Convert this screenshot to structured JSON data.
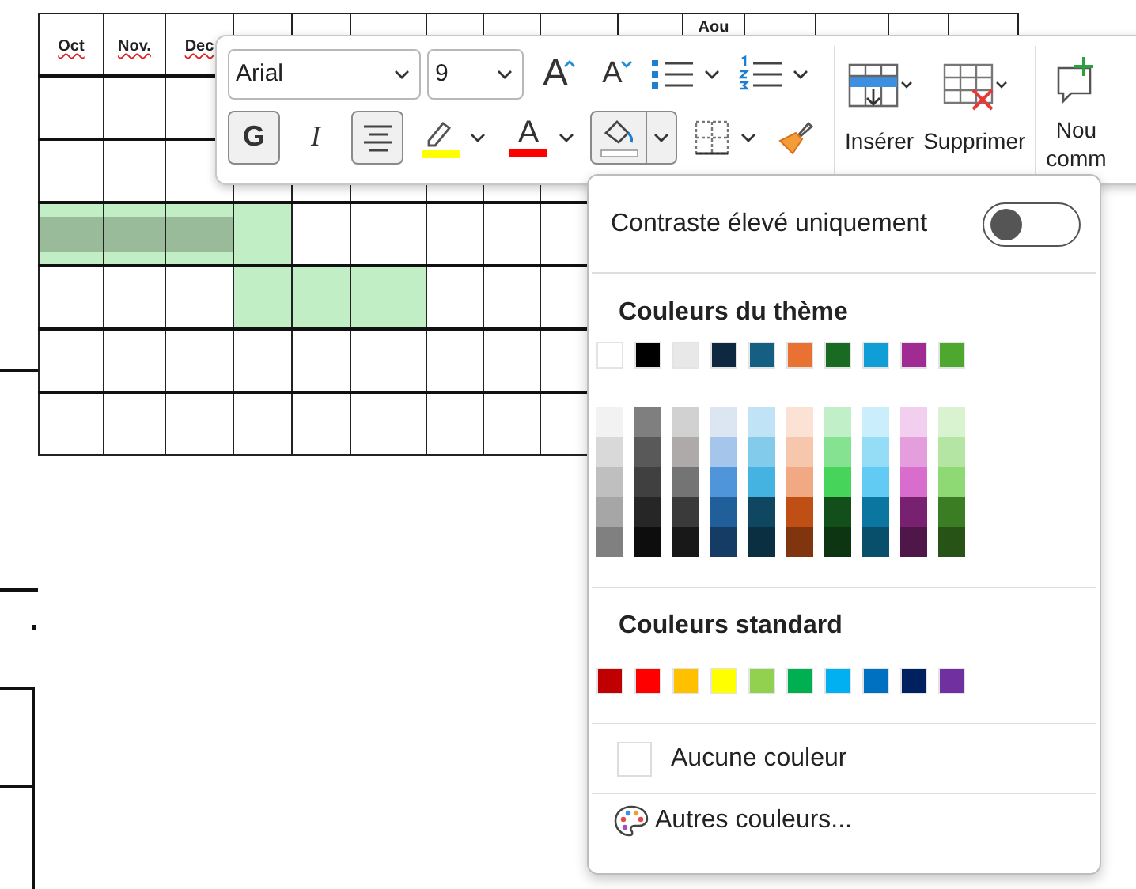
{
  "document": {
    "table": {
      "header_labels": [
        {
          "text": "Oct",
          "misspelled": true
        },
        {
          "text": "Nov.",
          "misspelled": true
        },
        {
          "text": "Dec",
          "misspelled": true
        }
      ],
      "cut_header": "Aou",
      "rows": [
        {
          "cells": [
            {
              "shaded": false
            },
            {
              "shaded": false
            },
            {
              "shaded": false
            }
          ]
        },
        {
          "cells": [
            {
              "shaded": false
            },
            {
              "shaded": false
            },
            {
              "shaded": false
            },
            {
              "shaded": false
            },
            {
              "shaded": false
            },
            {
              "shaded": false
            },
            {
              "shaded": false
            },
            {
              "shaded": false
            },
            {
              "shaded": false
            }
          ]
        },
        {
          "cells": [
            {
              "shaded": true,
              "selected": true
            },
            {
              "shaded": true,
              "selected": true
            },
            {
              "shaded": true,
              "selected": true
            },
            {
              "shaded": true,
              "selected": false
            },
            {
              "shaded": false,
              "selected": false
            },
            {
              "shaded": false,
              "selected": false
            },
            {
              "shaded": false,
              "selected": false
            },
            {
              "shaded": false,
              "selected": false
            },
            {
              "shaded": false,
              "selected": false
            }
          ]
        },
        {
          "cells": [
            {
              "shaded": false
            },
            {
              "shaded": false
            },
            {
              "shaded": false
            },
            {
              "shaded": true
            },
            {
              "shaded": true
            },
            {
              "shaded": true
            },
            {
              "shaded": false
            },
            {
              "shaded": false
            },
            {
              "shaded": false
            }
          ]
        },
        {
          "cells": [
            {
              "shaded": false
            },
            {
              "shaded": false
            },
            {
              "shaded": false
            },
            {
              "shaded": false
            },
            {
              "shaded": false
            },
            {
              "shaded": false
            },
            {
              "shaded": false
            },
            {
              "shaded": false
            },
            {
              "shaded": false
            }
          ]
        },
        {
          "cells": [
            {
              "shaded": false
            },
            {
              "shaded": false
            },
            {
              "shaded": false
            },
            {
              "shaded": false
            },
            {
              "shaded": false
            },
            {
              "shaded": false
            },
            {
              "shaded": false
            },
            {
              "shaded": false
            },
            {
              "shaded": false
            }
          ]
        }
      ]
    }
  },
  "mini_toolbar": {
    "font_field": {
      "value": "Arial"
    },
    "size_field": {
      "value": "9"
    },
    "row_1": [
      {
        "kind": "grow_font",
        "glyph": "A"
      },
      {
        "kind": "shrink_font",
        "glyph": "A"
      },
      {
        "kind": "bullets"
      },
      {
        "kind": "numbering"
      }
    ],
    "row_2": [
      {
        "kind": "bold",
        "glyph": "G",
        "on": true
      },
      {
        "kind": "italic",
        "glyph": "I",
        "on": false
      },
      {
        "kind": "align_center",
        "on": true
      },
      {
        "kind": "highlight"
      },
      {
        "kind": "font_color",
        "glyph": "A"
      },
      {
        "kind": "fill",
        "expanded": true
      },
      {
        "kind": "borders"
      },
      {
        "kind": "format_painter"
      }
    ],
    "actions": [
      {
        "kind": "insert",
        "label": "Insérer"
      },
      {
        "kind": "delete",
        "label": "Supprimer"
      },
      {
        "kind": "comment",
        "label_lines": [
          "Nou",
          "comm"
        ]
      }
    ]
  },
  "color_menu": {
    "contrast_toggle": {
      "label": "Contraste élevé uniquement",
      "on": false
    },
    "theme_heading": "Couleurs du thème",
    "theme_colors": [
      {
        "color": "#ffffff"
      },
      {
        "color": "#000000"
      },
      {
        "color": "#e8e8e8"
      },
      {
        "color": "#0e2841"
      },
      {
        "color": "#156082"
      },
      {
        "color": "#e97132"
      },
      {
        "color": "#196b24"
      },
      {
        "color": "#0f9ed5"
      },
      {
        "color": "#a02b93"
      },
      {
        "color": "#4ea72e"
      }
    ],
    "theme_shades": [
      [
        {
          "color": "#f2f2f2"
        },
        {
          "color": "#d9d9d9"
        },
        {
          "color": "#bfbfbf"
        },
        {
          "color": "#a6a6a6"
        },
        {
          "color": "#808080"
        }
      ],
      [
        {
          "color": "#7f7f7f"
        },
        {
          "color": "#595959"
        },
        {
          "color": "#404040"
        },
        {
          "color": "#262626"
        },
        {
          "color": "#0d0d0d"
        }
      ],
      [
        {
          "color": "#d1d1d1"
        },
        {
          "color": "#aeaaaa"
        },
        {
          "color": "#747474"
        },
        {
          "color": "#3a3a3a"
        },
        {
          "color": "#181818"
        }
      ],
      [
        {
          "color": "#dce6f3"
        },
        {
          "color": "#a5c6ea"
        },
        {
          "color": "#4f95d9"
        },
        {
          "color": "#215f9a"
        },
        {
          "color": "#153c64"
        }
      ],
      [
        {
          "color": "#c0e4f5"
        },
        {
          "color": "#83cbeb"
        },
        {
          "color": "#44b3e1"
        },
        {
          "color": "#0f4761"
        },
        {
          "color": "#0a2f41"
        }
      ],
      [
        {
          "color": "#fbe2d5"
        },
        {
          "color": "#f6c6ad"
        },
        {
          "color": "#f1a983"
        },
        {
          "color": "#c04f15"
        },
        {
          "color": "#80350e"
        }
      ],
      [
        {
          "color": "#c1f0c8"
        },
        {
          "color": "#84e291"
        },
        {
          "color": "#47d45a"
        },
        {
          "color": "#124f1a"
        },
        {
          "color": "#0d3512"
        }
      ],
      [
        {
          "color": "#caeefb"
        },
        {
          "color": "#95dcf7"
        },
        {
          "color": "#61cbf3"
        },
        {
          "color": "#0b76a0"
        },
        {
          "color": "#074f6a"
        }
      ],
      [
        {
          "color": "#f2ceef"
        },
        {
          "color": "#e59edd"
        },
        {
          "color": "#d86dcd"
        },
        {
          "color": "#782170"
        },
        {
          "color": "#4f1649"
        }
      ],
      [
        {
          "color": "#d9f2d0"
        },
        {
          "color": "#b4e5a2"
        },
        {
          "color": "#8ed973"
        },
        {
          "color": "#3b7d23"
        },
        {
          "color": "#275317"
        }
      ]
    ],
    "standard_heading": "Couleurs standard",
    "standard_colors": [
      {
        "color": "#c00000"
      },
      {
        "color": "#ff0000"
      },
      {
        "color": "#ffc000"
      },
      {
        "color": "#ffff00"
      },
      {
        "color": "#92d050"
      },
      {
        "color": "#00b050"
      },
      {
        "color": "#00b0f0"
      },
      {
        "color": "#0070c0"
      },
      {
        "color": "#002060"
      },
      {
        "color": "#7030a0"
      }
    ],
    "no_color": {
      "label": "Aucune couleur"
    },
    "more_colors": {
      "label": "Autres couleurs..."
    }
  }
}
